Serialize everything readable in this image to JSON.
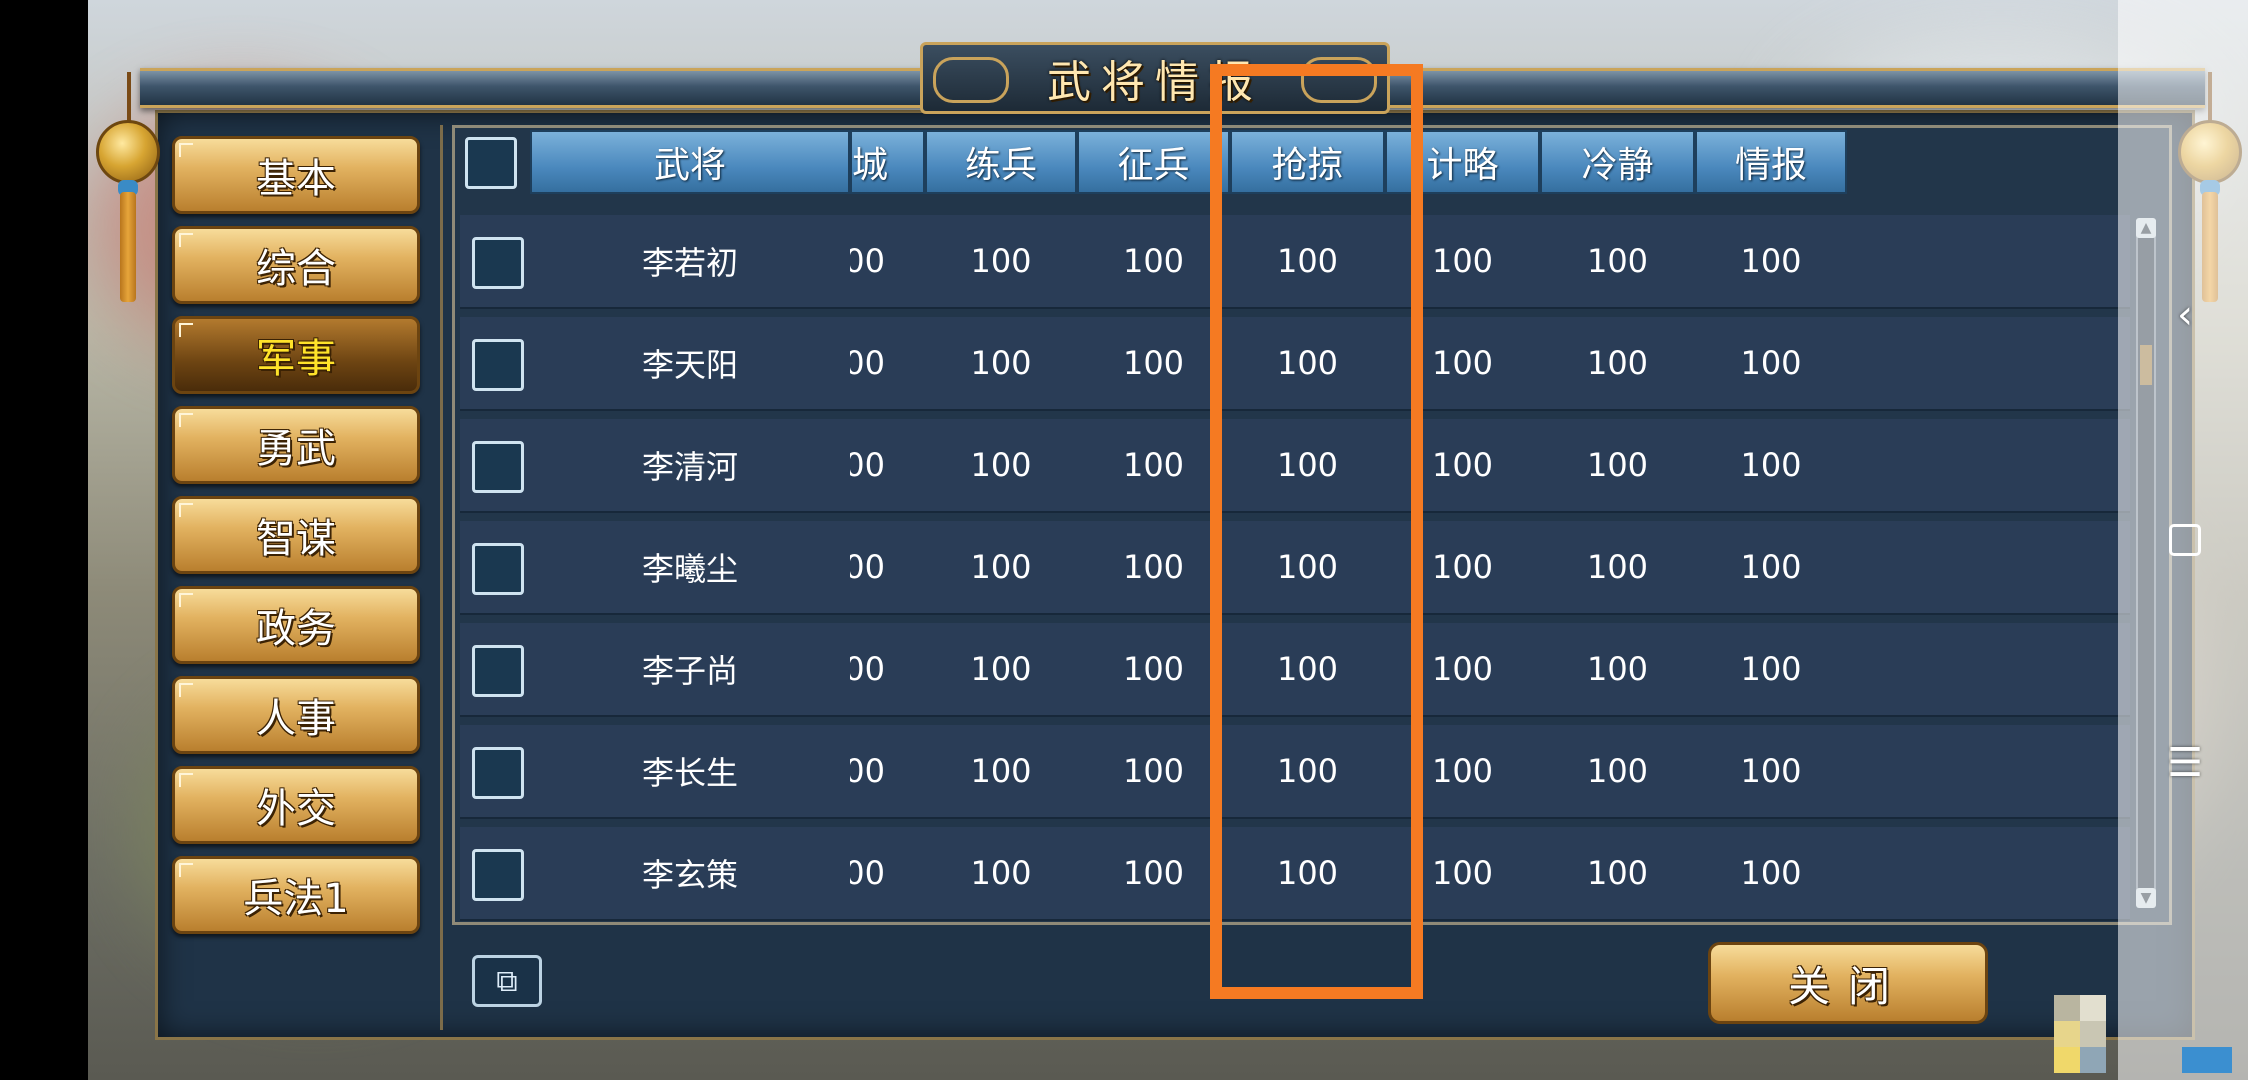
{
  "title": "武将情报",
  "sidebar": {
    "items": [
      {
        "label": "基本"
      },
      {
        "label": "综合"
      },
      {
        "label": "军事"
      },
      {
        "label": "勇武"
      },
      {
        "label": "智谋"
      },
      {
        "label": "政务"
      },
      {
        "label": "人事"
      },
      {
        "label": "外交"
      },
      {
        "label": "兵法1"
      }
    ],
    "active_index": 2
  },
  "table": {
    "columns": [
      "武将",
      "城",
      "练兵",
      "征兵",
      "抢掠",
      "计略",
      "冷静",
      "情报"
    ],
    "rows": [
      {
        "name": "李若初",
        "values": [
          "00",
          "100",
          "100",
          "100",
          "100",
          "100",
          "100"
        ]
      },
      {
        "name": "李天阳",
        "values": [
          "00",
          "100",
          "100",
          "100",
          "100",
          "100",
          "100"
        ]
      },
      {
        "name": "李清河",
        "values": [
          "00",
          "100",
          "100",
          "100",
          "100",
          "100",
          "100"
        ]
      },
      {
        "name": "李曦尘",
        "values": [
          "00",
          "100",
          "100",
          "100",
          "100",
          "100",
          "100"
        ]
      },
      {
        "name": "李子尚",
        "values": [
          "00",
          "100",
          "100",
          "100",
          "100",
          "100",
          "100"
        ]
      },
      {
        "name": "李长生",
        "values": [
          "00",
          "100",
          "100",
          "100",
          "100",
          "100",
          "100"
        ]
      },
      {
        "name": "李玄策",
        "values": [
          "00",
          "100",
          "100",
          "100",
          "100",
          "100",
          "100"
        ]
      }
    ]
  },
  "close_label": "关闭",
  "highlight_color": "#f57a22",
  "icons": {
    "zoom": "zoom-icon",
    "nav_back": "chevron-left-icon",
    "nav_home": "square-icon",
    "nav_menu": "menu-icon"
  }
}
